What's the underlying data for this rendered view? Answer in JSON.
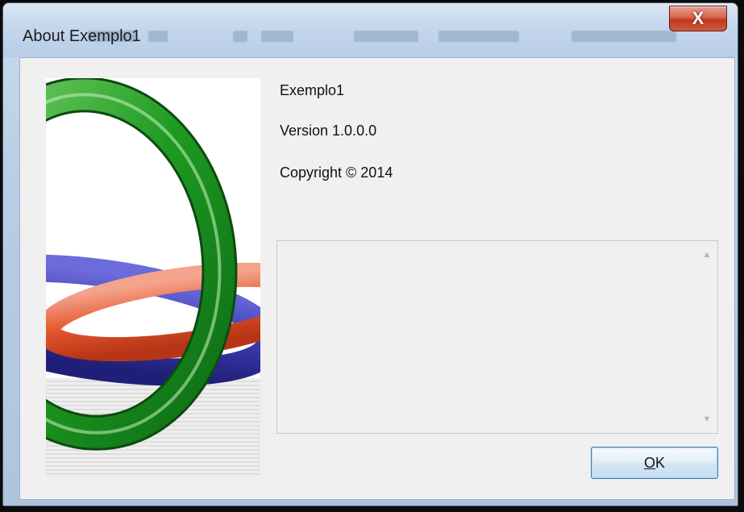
{
  "window": {
    "title": "About Exemplo1",
    "close_glyph": "X"
  },
  "app": {
    "product_name": "Exemplo1",
    "version": "Version 1.0.0.0",
    "copyright": "Copyright ©  2014"
  },
  "description": {
    "text": "",
    "scroll_up_icon": "triangle-up",
    "scroll_down_icon": "triangle-down"
  },
  "buttons": {
    "ok_label": "OK",
    "ok_mnemonic": "O"
  },
  "colors": {
    "ring_green": "#2aa02a",
    "ring_orange": "#e4572e",
    "ring_blue": "#3b3bb0",
    "button_border": "#3c7fb1",
    "close_red": "#c0391f"
  }
}
